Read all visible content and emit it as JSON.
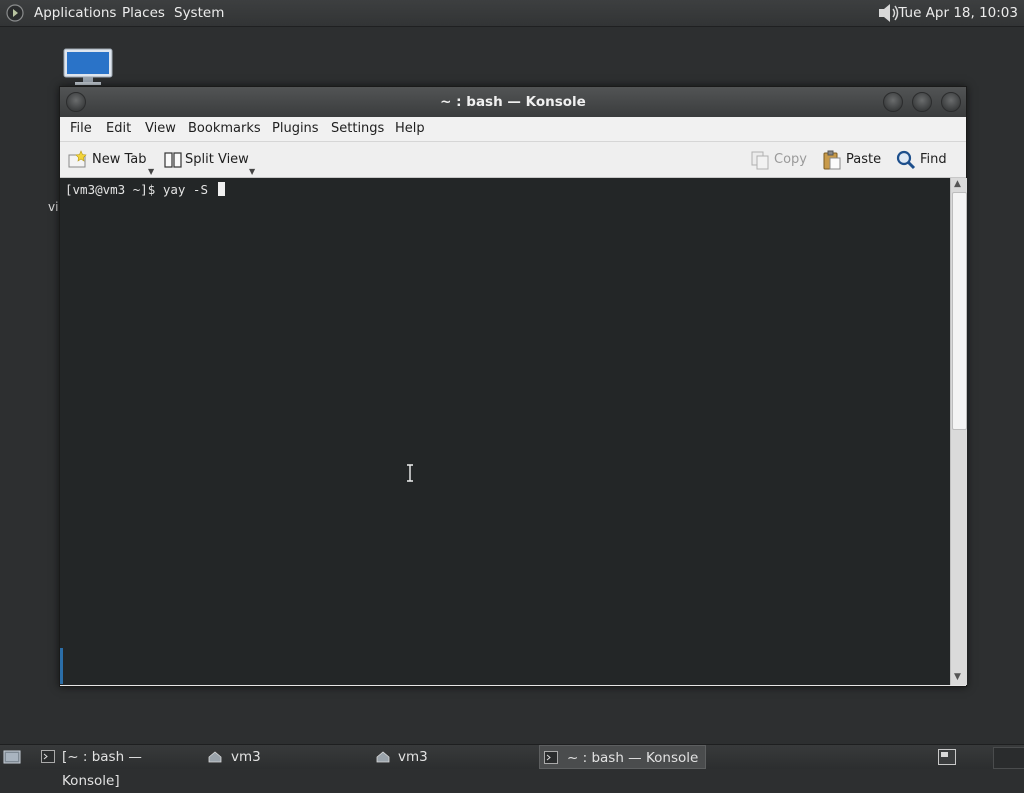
{
  "top_panel": {
    "menus": [
      "Applications",
      "Places",
      "System"
    ],
    "clock": "Tue Apr 18, 10:03"
  },
  "desktop": {
    "label_fragment": "vi"
  },
  "window": {
    "title": "~ : bash — Konsole",
    "menu": [
      "File",
      "Edit",
      "View",
      "Bookmarks",
      "Plugins",
      "Settings",
      "Help"
    ],
    "toolbar": {
      "new_tab": "New Tab",
      "split_view": "Split View",
      "copy": "Copy",
      "paste": "Paste",
      "find": "Find"
    },
    "terminal": {
      "prompt": "[vm3@vm3 ~]$ yay -S "
    }
  },
  "taskbar": {
    "tasks": [
      "[~ : bash — Konsole]",
      "vm3",
      "vm3",
      "~ : bash — Konsole"
    ]
  },
  "colors": {
    "terminal_bg": "#232627",
    "panel_bg": "#323435",
    "accent": "#2b6ea8"
  }
}
